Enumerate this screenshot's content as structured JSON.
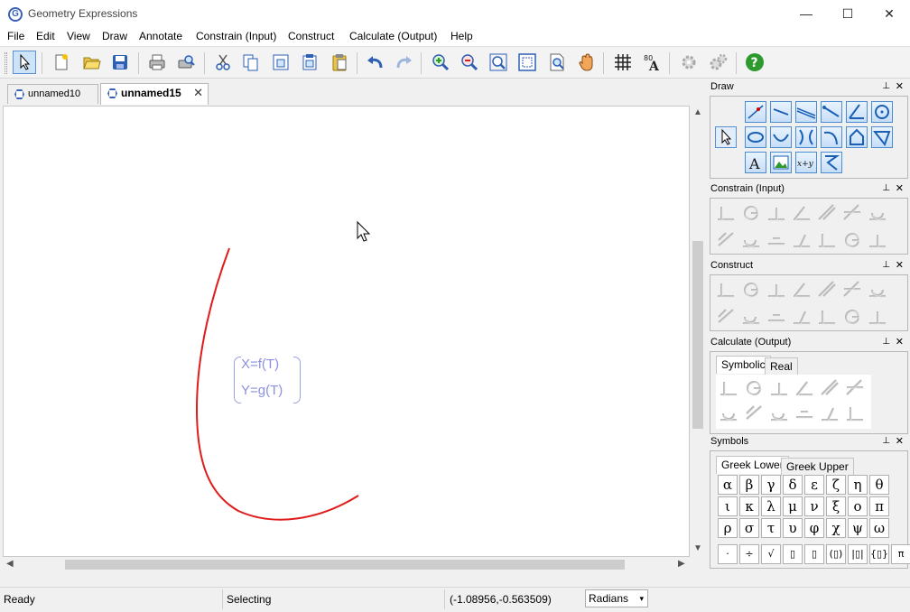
{
  "window": {
    "title": "Geometry Expressions",
    "app_icon_letter": "G",
    "min_glyph": "—",
    "max_glyph": "☐",
    "close_glyph": "✕"
  },
  "menu": [
    "File",
    "Edit",
    "View",
    "Draw",
    "Annotate",
    "Constrain (Input)",
    "Construct",
    "Calculate (Output)",
    "Help"
  ],
  "toolbar": {
    "buttons": [
      "select-arrow",
      "new-file",
      "open-folder",
      "save",
      "print",
      "print-preview",
      "cut",
      "copy",
      "copy-special",
      "paste-special",
      "paste",
      "undo",
      "redo",
      "zoom-in",
      "zoom-out",
      "zoom-fit",
      "zoom-window",
      "zoom-page",
      "pan-hand",
      "grid",
      "font-size",
      "settings-gear",
      "settings-gears",
      "help"
    ],
    "active": "select-arrow"
  },
  "tabs": [
    {
      "label": "unnamed10",
      "active": false
    },
    {
      "label": "unnamed15",
      "active": true,
      "close": "✕"
    }
  ],
  "canvas": {
    "formula_lines": [
      "X=f(T)",
      "Y=g(T)"
    ],
    "curve_color": "#e01b1b",
    "formula_color": "#8a90e3"
  },
  "panels": {
    "draw": {
      "title": "Draw"
    },
    "constrain": {
      "title": "Constrain (Input)"
    },
    "construct": {
      "title": "Construct"
    },
    "calculate": {
      "title": "Calculate (Output)",
      "tabs": [
        "Symbolic",
        "Real"
      ],
      "active_tab": "Symbolic"
    },
    "symbols": {
      "title": "Symbols",
      "tabs": [
        "Greek Lower",
        "Greek Upper"
      ],
      "active_tab": "Greek Lower",
      "greek": [
        "α",
        "β",
        "γ",
        "δ",
        "ε",
        "ζ",
        "η",
        "θ",
        "ι",
        "κ",
        "λ",
        "μ",
        "ν",
        "ξ",
        "ο",
        "π",
        "ρ",
        "σ",
        "τ",
        "υ",
        "φ",
        "χ",
        "ψ",
        "ω"
      ],
      "operators": [
        "·",
        "÷",
        "√",
        "▯",
        "▯",
        "(▯)",
        "|▯|",
        "{▯}",
        "π"
      ]
    }
  },
  "panel_controls": {
    "pin": "📌",
    "close": "✕"
  },
  "status": {
    "left": "Ready",
    "mode": "Selecting",
    "coords": "(-1.08956,-0.563509)",
    "units": "Radians",
    "units_arrow": "▾"
  },
  "scroll": {
    "up": "▲",
    "down": "▼",
    "left": "◀",
    "right": "▶"
  }
}
